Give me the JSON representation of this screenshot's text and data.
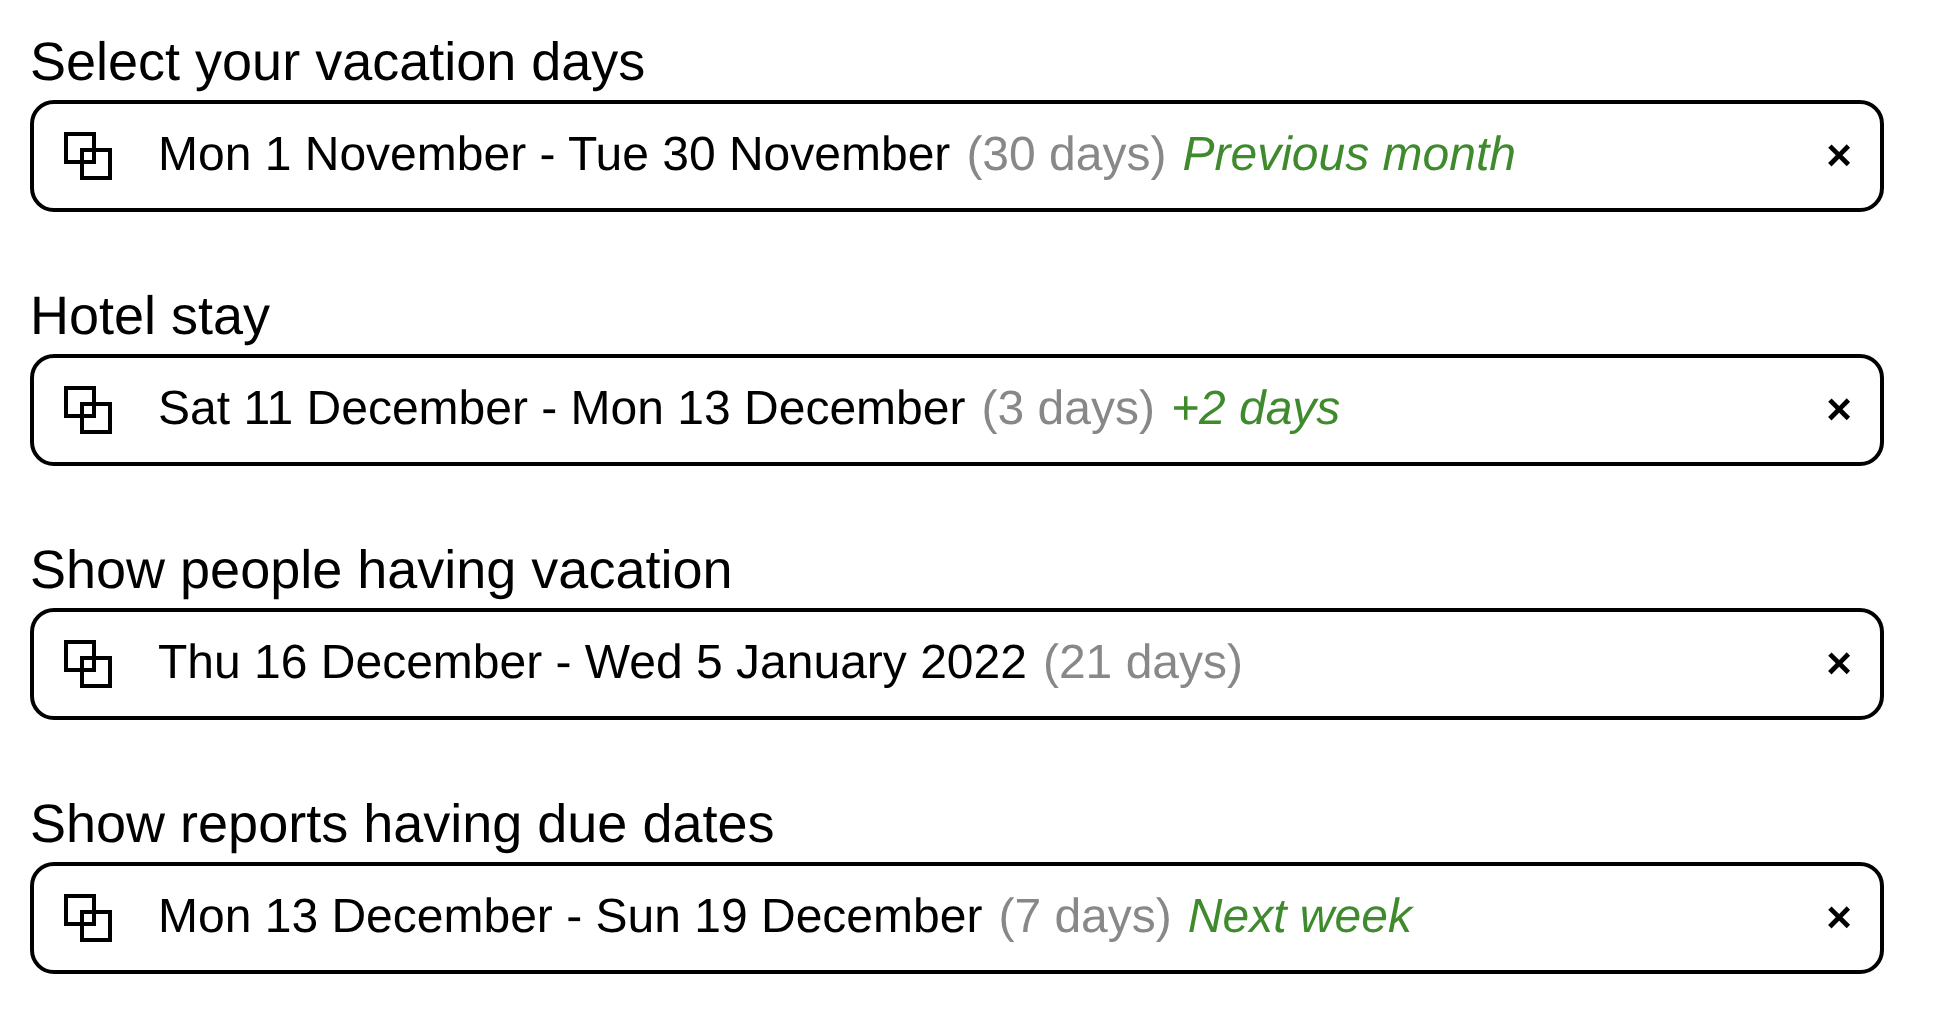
{
  "fields": [
    {
      "label": "Select your vacation days",
      "value": "Mon 1 November - Tue 30 November",
      "duration": "(30 days)",
      "hint": "Previous month"
    },
    {
      "label": "Hotel stay",
      "value": "Sat 11 December - Mon 13 December",
      "duration": "(3 days)",
      "hint": "+2 days"
    },
    {
      "label": "Show people having vacation",
      "value": "Thu 16 December - Wed 5 January 2022",
      "duration": "(21 days)"
    },
    {
      "label": "Show reports having due dates",
      "value": "Mon 13 December - Sun 19 December",
      "duration": "(7 days)",
      "hint": "Next week"
    }
  ],
  "clear_symbol": "×"
}
